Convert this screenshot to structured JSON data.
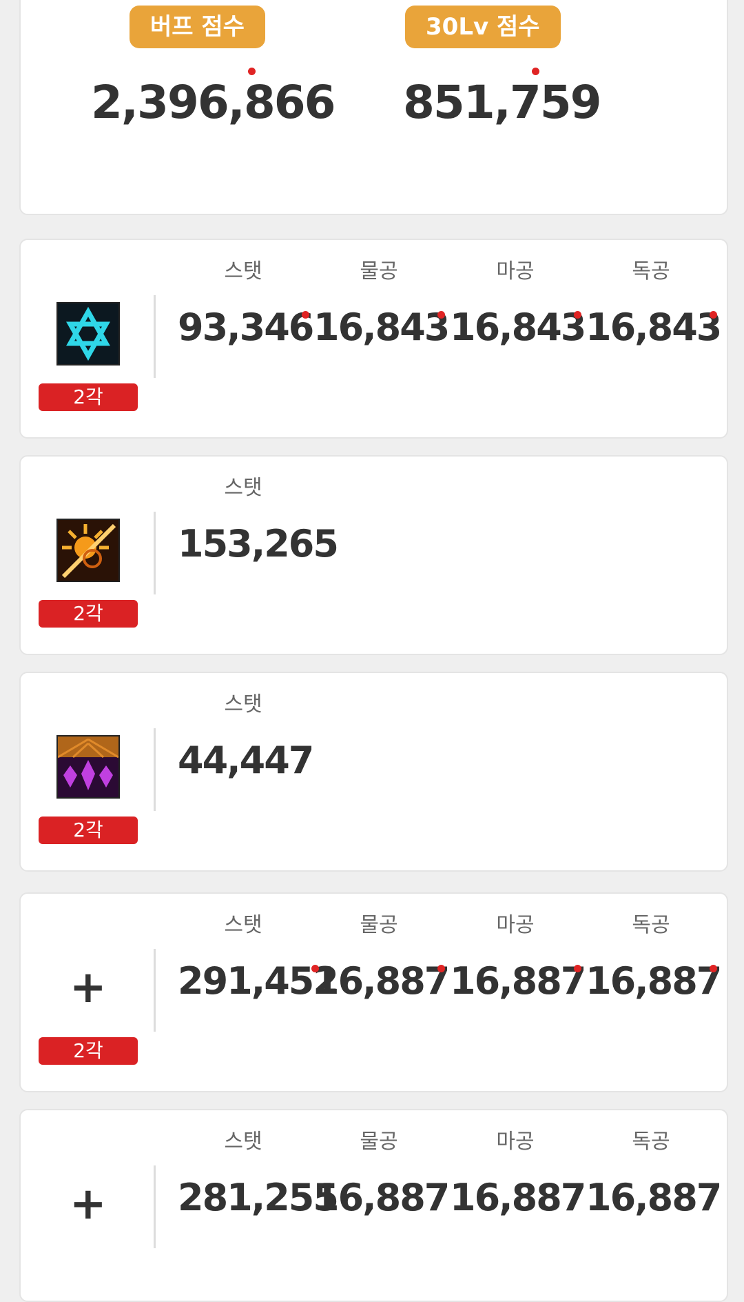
{
  "scores": {
    "buff_label": "버프 점수",
    "buff_value": "2,396,866",
    "lv30_label": "30Lv 점수",
    "lv30_value": "851,759"
  },
  "col_labels": [
    "스탯",
    "물공",
    "마공",
    "독공"
  ],
  "cards": [
    {
      "icon": "hexagram-skill-icon",
      "rank": "2각",
      "values": [
        "93,346",
        "16,843",
        "16,843",
        "16,843"
      ]
    },
    {
      "icon": "sun-burst-skill-icon",
      "rank": "2각",
      "values": [
        "153,265"
      ]
    },
    {
      "icon": "purple-crystal-skill-icon",
      "rank": "2각",
      "values": [
        "44,447"
      ]
    },
    {
      "icon": "plus-icon",
      "rank": "2각",
      "values": [
        "291,452",
        "16,887",
        "16,887",
        "16,887"
      ]
    },
    {
      "icon": "plus-icon",
      "values": [
        "281,255",
        "16,887",
        "16,887",
        "16,887"
      ]
    }
  ],
  "colors": {
    "accent_badge": "#e9a43a",
    "rank_badge": "#da2224",
    "indicator_dot": "#e02424"
  }
}
